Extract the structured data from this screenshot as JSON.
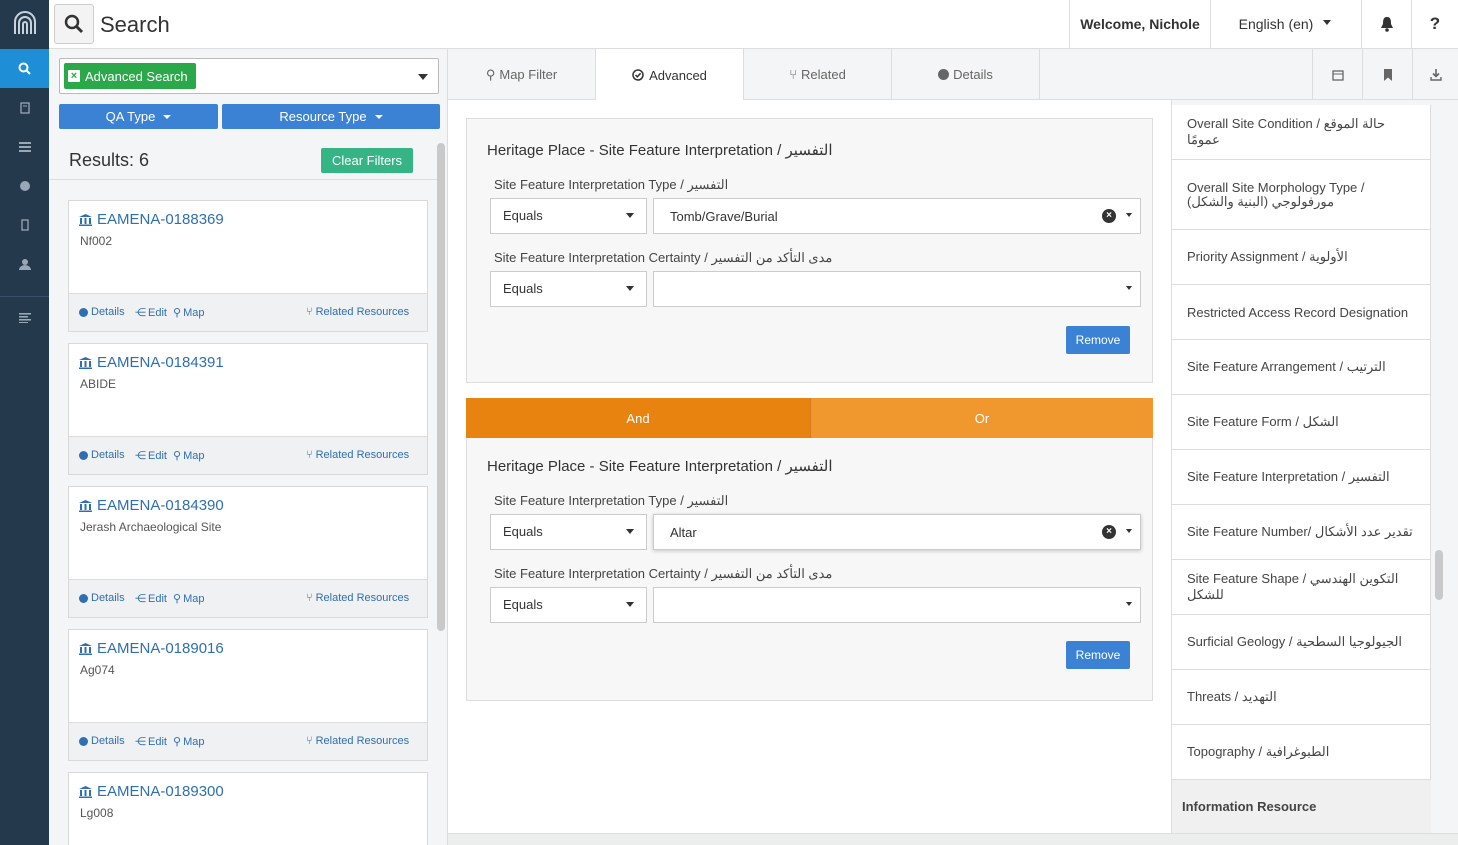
{
  "topbar": {
    "title": "Search",
    "welcome": "Welcome, Nichole",
    "language": "English (en)",
    "help": "?"
  },
  "search": {
    "tag_label": "Advanced Search",
    "filters": [
      "QA Type",
      "Resource Type"
    ]
  },
  "results": {
    "label": "Results: 6",
    "clear_label": "Clear Filters",
    "cards": [
      {
        "id": "EAMENA-0188369",
        "name": "Nf002"
      },
      {
        "id": "EAMENA-0184391",
        "name": "ABIDE"
      },
      {
        "id": "EAMENA-0184390",
        "name": "Jerash Archaeological Site"
      },
      {
        "id": "EAMENA-0189016",
        "name": "Ag074"
      },
      {
        "id": "EAMENA-0189300",
        "name": "Lg008"
      }
    ],
    "actions": {
      "details": "Details",
      "edit": "Edit",
      "map": "Map",
      "related": "Related Resources"
    }
  },
  "tabs": [
    "Map Filter",
    "Advanced",
    "Related",
    "Details"
  ],
  "advanced": {
    "panels": [
      {
        "title": "Heritage Place - Site Feature Interpretation / التفسير",
        "type_label": "Site Feature Interpretation Type / التفسير",
        "type_op": "Equals",
        "type_value": "Tomb/Grave/Burial",
        "certainty_label": "Site Feature Interpretation Certainty / مدى التأكد من التفسير",
        "certainty_op": "Equals",
        "certainty_value": "",
        "remove_label": "Remove"
      },
      {
        "title": "Heritage Place - Site Feature Interpretation / التفسير",
        "type_label": "Site Feature Interpretation Type / التفسير",
        "type_op": "Equals",
        "type_value": "Altar",
        "certainty_label": "Site Feature Interpretation Certainty / مدى التأكد من التفسير",
        "certainty_op": "Equals",
        "certainty_value": "",
        "remove_label": "Remove"
      }
    ],
    "and_label": "And",
    "or_label": "Or"
  },
  "right_list": {
    "items": [
      "Overall Site Condition / حالة الموقع عمومًا",
      "Overall Site Morphology Type / مورفولوجي (البنية والشكل)",
      "Priority Assignment / الأولوية",
      "Restricted Access Record Designation",
      "Site Feature Arrangement / الترتيب",
      "Site Feature Form / الشكل",
      "Site Feature Interpretation / التفسير",
      "Site Feature Number/ تقدير عدد الأشكال",
      "Site Feature Shape / التكوين الهندسي للشكل",
      "Surficial Geology / الجيولوجيا السطحية",
      "Threats / التهديد",
      "Topography / الطبوغرافية"
    ],
    "section_head": "Information Resource"
  },
  "colors": {
    "rail": "#25394d",
    "accent": "#1e8fd6",
    "primary": "#3b82d4",
    "green": "#35b586",
    "orange": "#e8830f"
  }
}
